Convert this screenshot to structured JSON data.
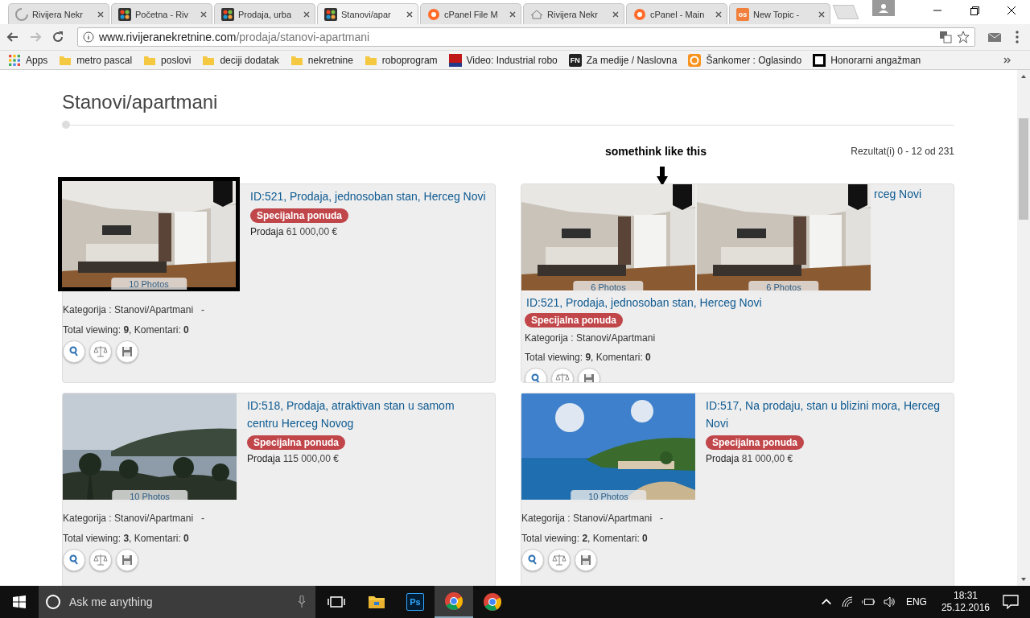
{
  "tabs": [
    {
      "title": "Rivijera Nekr",
      "selected": false
    },
    {
      "title": "Početna - Riv",
      "selected": false
    },
    {
      "title": "Prodaja, urba",
      "selected": false
    },
    {
      "title": "Stanovi/apar",
      "selected": true
    },
    {
      "title": "cPanel File M",
      "selected": false
    },
    {
      "title": "Rivijera Nekr",
      "selected": false
    },
    {
      "title": "cPanel - Main",
      "selected": false
    },
    {
      "title": "New Topic -",
      "icon_text": "os",
      "selected": false
    }
  ],
  "address": {
    "host": "www.rivijeranekretnine.com",
    "path": "/prodaja/stanovi-apartmani"
  },
  "bookmarks": [
    {
      "label": "Apps"
    },
    {
      "label": "metro pascal"
    },
    {
      "label": "poslovi"
    },
    {
      "label": "deciji dodatak"
    },
    {
      "label": "nekretnine"
    },
    {
      "label": "roboprogram"
    },
    {
      "label": "Video: Industrial robo"
    },
    {
      "label": "Za medije / Naslovna",
      "icon_text": "FN"
    },
    {
      "label": "Šankomer : Oglasindo"
    },
    {
      "label": "Honorarni angažman"
    }
  ],
  "page": {
    "title": "Stanovi/apartmani",
    "annotation": "somethink like this",
    "results": "Rezultat(i) 0 - 12 od 231"
  },
  "listings": [
    {
      "kind": "listing",
      "highlighted": true,
      "title": "ID:521, Prodaja, jednosoban stan, Herceg Novi",
      "badge": "Specijalna ponuda",
      "price": "**Prodaja** 61 000,00 €",
      "photos": "10 Photos",
      "category": "Kategorija : Stanovi/Apartmani",
      "separator": "-",
      "stats": "Total viewing: **9**, Komentari: **0**"
    },
    {
      "kind": "mockup",
      "title_fragment": "rceg Novi",
      "images": [
        {
          "photos": "6 Photos"
        },
        {
          "photos": "6 Photos"
        }
      ],
      "title": "ID:521, Prodaja, jednosoban stan, Herceg Novi",
      "badge": "Specijalna ponuda",
      "category": "Kategorija : Stanovi/Apartmani",
      "stats": "Total viewing: **9**, Komentari: **0**"
    },
    {
      "kind": "listing",
      "highlighted": false,
      "title": "ID:518, Prodaja, atraktivan stan u samom centru Herceg Novog",
      "badge": "Specijalna ponuda",
      "price": "**Prodaja** 115 000,00 €",
      "photos": "10 Photos",
      "category": "Kategorija : Stanovi/Apartmani",
      "separator": "-",
      "stats": "Total viewing: **3**, Komentari: **0**"
    },
    {
      "kind": "listing",
      "highlighted": false,
      "title": "ID:517, Na prodaju, stan u blizini mora, Herceg Novi",
      "badge": "Specijalna ponuda",
      "price": "**Prodaja** 81 000,00 €",
      "photos": "10 Photos",
      "category": "Kategorija : Stanovi/Apartmani",
      "separator": "-",
      "stats": "Total viewing: **2**, Komentari: **0**"
    }
  ],
  "taskbar": {
    "search_placeholder": "Ask me anything",
    "apps": [
      {
        "selected": false
      },
      {
        "icon_text": "Ps",
        "selected": false
      },
      {
        "selected": true
      },
      {
        "selected": false
      }
    ],
    "language": "ENG",
    "time": "18:31",
    "date": "25.12.2016"
  }
}
